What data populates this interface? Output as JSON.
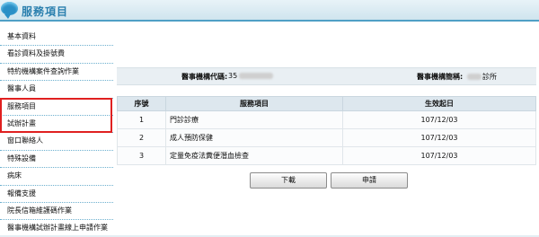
{
  "header": {
    "title": "服務項目"
  },
  "sidebar": {
    "items": [
      {
        "label": "基本資料"
      },
      {
        "label": "看診資料及掛號費"
      },
      {
        "label": "特約機構案件查詢作業"
      },
      {
        "label": "醫事人員"
      },
      {
        "label": "服務項目"
      },
      {
        "label": "試辦計畫"
      },
      {
        "label": "窗口聯絡人"
      },
      {
        "label": "特殊設備"
      },
      {
        "label": "病床"
      },
      {
        "label": "報備支援"
      },
      {
        "label": "院長信箱維護碼作業"
      },
      {
        "label": "醫事機構試辦計畫線上申請作業"
      }
    ],
    "highlight_color": "#e02020"
  },
  "info": {
    "code_label": "醫事機構代碼:",
    "code_value": "35",
    "name_label": "醫事機構簡稱:",
    "name_value": "診所"
  },
  "table": {
    "headers": {
      "no": "序號",
      "item": "服務項目",
      "date": "生效起日"
    },
    "rows": [
      {
        "no": "1",
        "item": "門診診療",
        "date": "107/12/03"
      },
      {
        "no": "2",
        "item": "成人預防保健",
        "date": "107/12/03"
      },
      {
        "no": "3",
        "item": "定量免疫法糞便潛血檢查",
        "date": "107/12/03"
      }
    ]
  },
  "buttons": {
    "download": "下載",
    "apply": "申請"
  },
  "colors": {
    "accent": "#2a7fae",
    "header_bg": "#cfe4ee",
    "row_bg": "#e9eff3"
  },
  "icons": {
    "header": "speech-bubble-icon"
  }
}
